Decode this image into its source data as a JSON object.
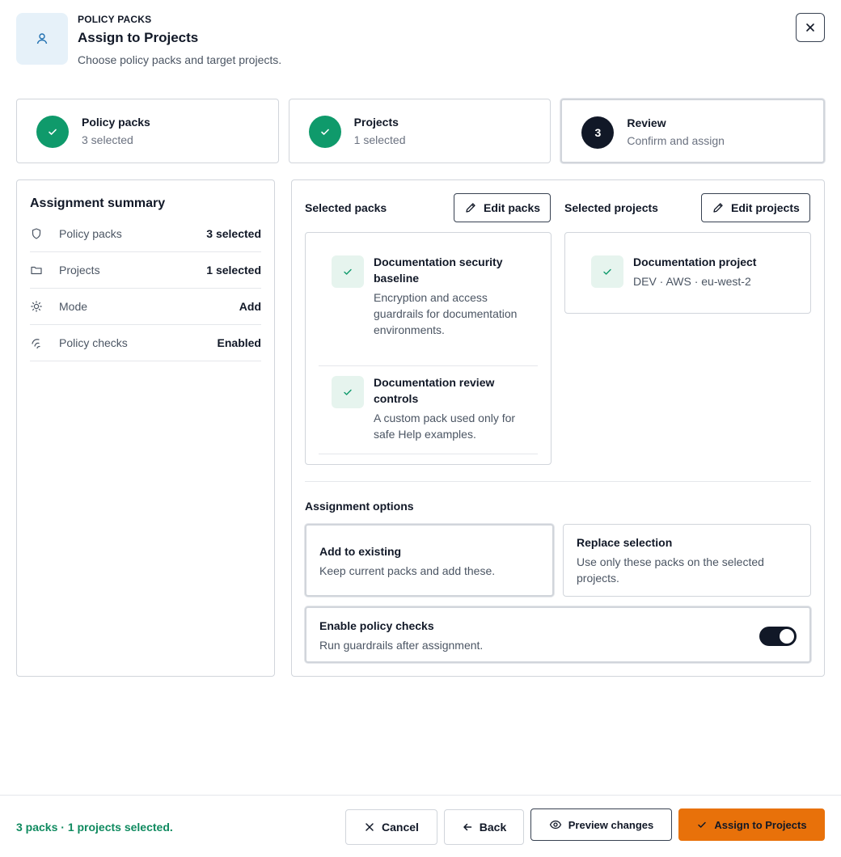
{
  "header": {
    "eyebrow": "POLICY PACKS",
    "title": "Assign to Projects",
    "subtitle": "Choose policy packs and target projects.",
    "icon": "user-icon",
    "close_icon": "close-icon"
  },
  "steps": [
    {
      "title": "Policy packs",
      "sub": "3 selected",
      "status": "complete"
    },
    {
      "title": "Projects",
      "sub": "1 selected",
      "status": "complete"
    },
    {
      "number": "3",
      "title": "Review",
      "sub": "Confirm and assign",
      "status": "current"
    }
  ],
  "summary": {
    "title": "Assignment summary",
    "rows": [
      {
        "icon": "shield-icon",
        "label": "Policy packs",
        "value": "3 selected"
      },
      {
        "icon": "folder-icon",
        "label": "Projects",
        "value": "1 selected"
      },
      {
        "icon": "sun-icon",
        "label": "Mode",
        "value": "Add"
      },
      {
        "icon": "checks-icon",
        "label": "Policy checks",
        "value": "Enabled"
      }
    ]
  },
  "packs": {
    "heading": "Selected packs",
    "edit_label": "Edit packs",
    "items": [
      {
        "title": "Documentation security baseline",
        "desc": "Encryption and access guardrails for documentation environments."
      },
      {
        "title": "Documentation review controls",
        "desc": "A custom pack used only for safe Help examples."
      }
    ]
  },
  "projects": {
    "heading": "Selected projects",
    "edit_label": "Edit projects",
    "items": [
      {
        "title": "Documentation project",
        "desc": "DEV · AWS · eu-west-2"
      }
    ]
  },
  "options": {
    "heading": "Assignment options",
    "add": {
      "title": "Add to existing",
      "desc": "Keep current packs and add these.",
      "selected": true
    },
    "replace": {
      "title": "Replace selection",
      "desc": "Use only these packs on the selected projects.",
      "selected": false
    },
    "checks": {
      "title": "Enable policy checks",
      "desc": "Run guardrails after assignment.",
      "enabled": true
    }
  },
  "footer": {
    "status": "3 packs · 1 projects selected.",
    "cancel_label": "Cancel",
    "back_label": "Back",
    "preview_label": "Preview changes",
    "assign_label": "Assign to Projects"
  },
  "colors": {
    "accent": "#e8710a",
    "success": "#0f9a6b",
    "success_text": "#0f8a5f",
    "dark": "#111827"
  }
}
